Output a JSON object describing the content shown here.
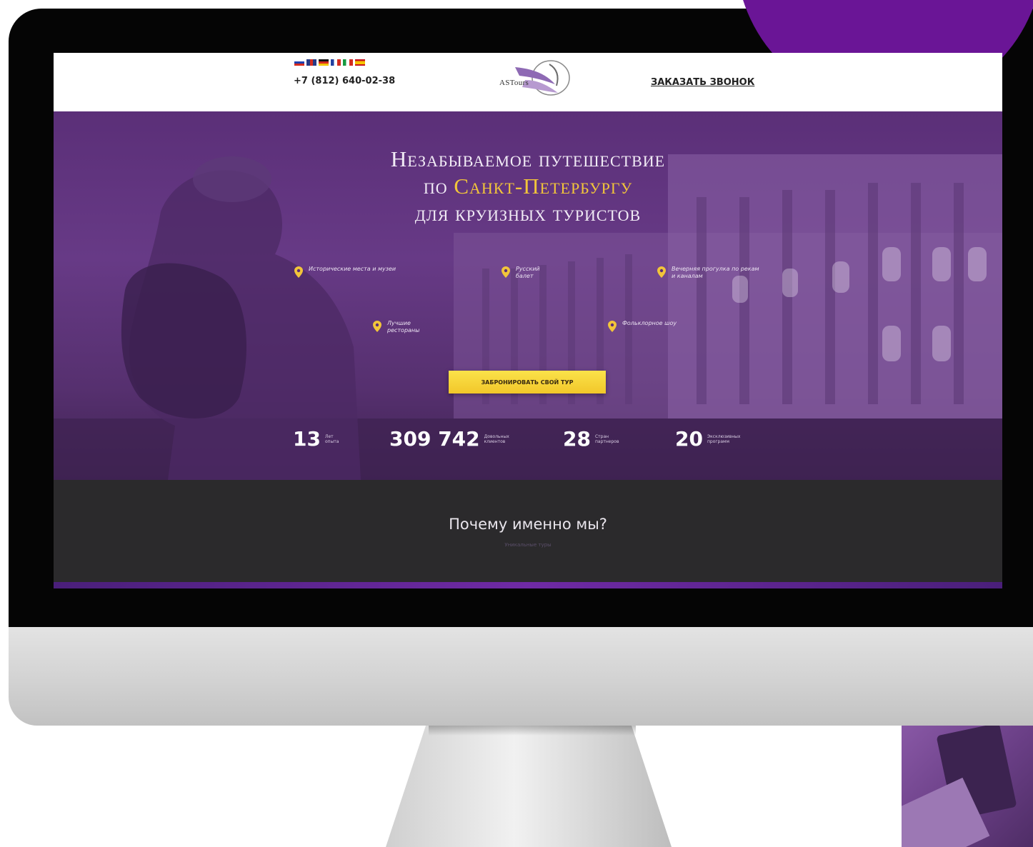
{
  "header": {
    "phone": "+7 (812) 640-02-38",
    "logo_text": "ASTours",
    "callback_label": "ЗАКАЗАТЬ ЗВОНОК",
    "languages": [
      "ru",
      "en",
      "de",
      "fr",
      "it",
      "es"
    ]
  },
  "hero": {
    "title_line1": "Незабываемое путешествие",
    "title_line2_prefix": "по ",
    "title_line2_highlight": "Санкт-Петербургу",
    "title_line3": "для круизных туристов",
    "features": [
      {
        "text": "Исторические места и музеи",
        "icon": "map-pin-icon"
      },
      {
        "text": "Русский балет",
        "icon": "map-pin-icon"
      },
      {
        "text": "Вечерняя прогулка по рекам и каналам",
        "icon": "map-pin-icon"
      },
      {
        "text": "Лучшие рестораны",
        "icon": "map-pin-icon"
      },
      {
        "text": "Фольклорное шоу",
        "icon": "map-pin-icon"
      }
    ],
    "cta_label": "ЗАБРОНИРОВАТЬ СВОЙ ТУР",
    "stats": [
      {
        "value": "13",
        "label": "Лет опыта"
      },
      {
        "value": "309 742",
        "label": "Довольных клиентов"
      },
      {
        "value": "28",
        "label": "Стран партнеров"
      },
      {
        "value": "20",
        "label": "Эксклюзивных программ"
      }
    ]
  },
  "why": {
    "title": "Почему именно мы?",
    "subtitle": "Уникальные туры"
  },
  "colors": {
    "accent_purple": "#6a1596",
    "hero_purple": "#5b2f78",
    "gold": "#f2c53a",
    "dark_section": "#2b2a2c"
  }
}
